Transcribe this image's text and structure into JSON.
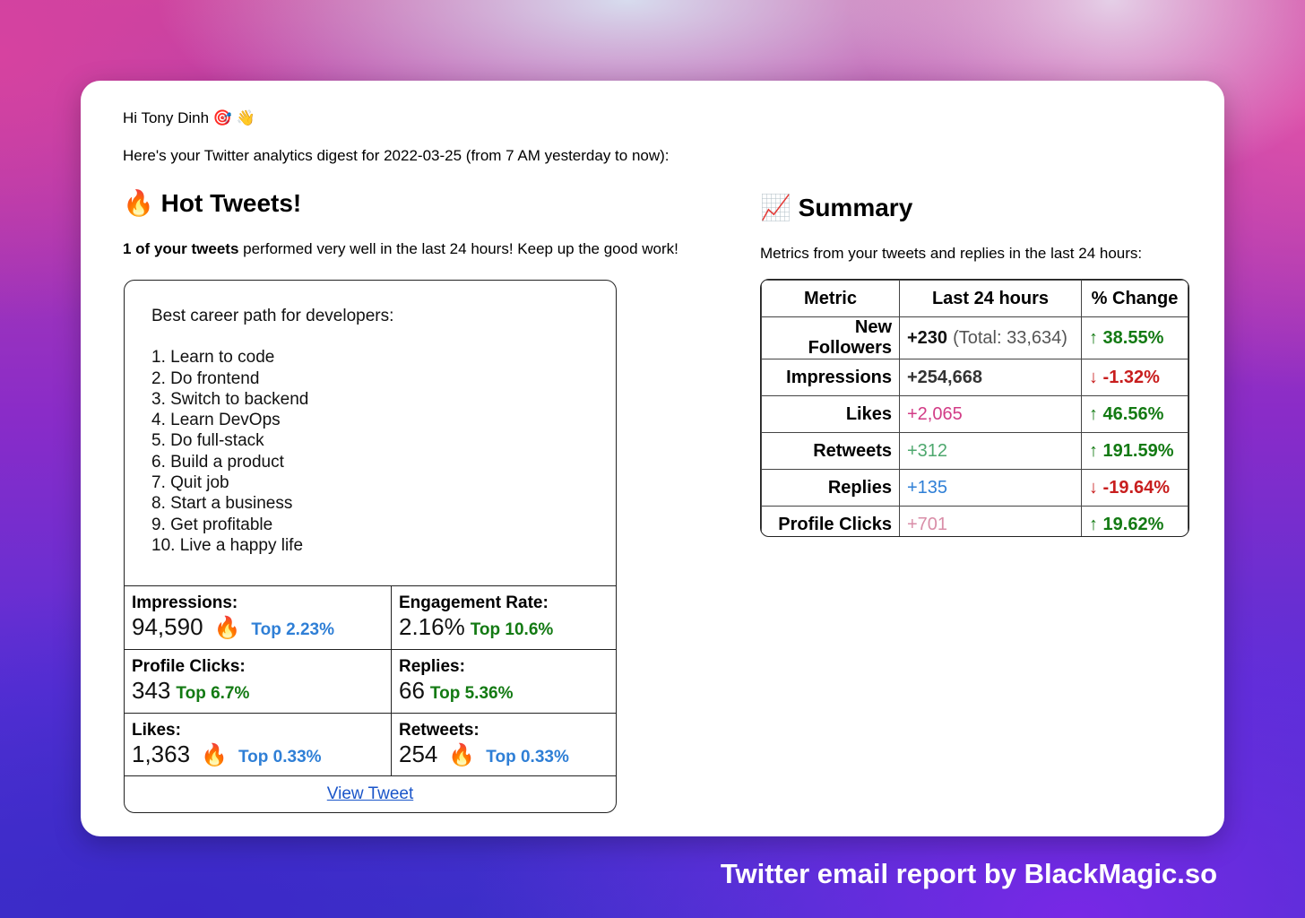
{
  "greeting": "Hi Tony Dinh 🎯 👋",
  "digest_text": "Here's your Twitter analytics digest for 2022-03-25 (from 7 AM yesterday to now):",
  "hot": {
    "icon": "🔥",
    "title": "Hot Tweets!",
    "sub_bold": "1 of your tweets",
    "sub_rest": " performed very well in the last 24 hours! Keep up the good work!",
    "tweet": {
      "heading": "Best career path for developers:",
      "lines": [
        "1. Learn to code",
        "2. Do frontend",
        "3. Switch to backend",
        "4. Learn DevOps",
        "5. Do full-stack",
        "6. Build a product",
        "7. Quit job",
        "8. Start a business",
        "9. Get profitable",
        "10. Live a happy life"
      ]
    },
    "stats": [
      {
        "label": "Impressions:",
        "value": "94,590",
        "fire": "🔥",
        "top": "Top 2.23%",
        "color": "#2f7fd6"
      },
      {
        "label": "Engagement Rate:",
        "value": "2.16%",
        "fire": "",
        "top": "Top 10.6%",
        "color": "#137a13"
      },
      {
        "label": "Profile Clicks:",
        "value": "343",
        "fire": "",
        "top": "Top 6.7%",
        "color": "#137a13"
      },
      {
        "label": "Replies:",
        "value": "66",
        "fire": "",
        "top": "Top 5.36%",
        "color": "#137a13"
      },
      {
        "label": "Likes:",
        "value": "1,363",
        "fire": "🔥",
        "top": "Top 0.33%",
        "color": "#2f7fd6"
      },
      {
        "label": "Retweets:",
        "value": "254",
        "fire": "🔥",
        "top": "Top 0.33%",
        "color": "#2f7fd6"
      }
    ],
    "view_link": "View Tweet"
  },
  "summary": {
    "icon": "📈",
    "title": "Summary",
    "sub": "Metrics from your tweets and replies in the last 24 hours:",
    "headers": [
      "Metric",
      "Last 24 hours",
      "% Change"
    ],
    "rows": [
      {
        "metric": "New Followers",
        "value": "+230",
        "extra": "(Total: 33,634)",
        "value_color": "#111",
        "change": "↑ 38.55%",
        "dir": "up"
      },
      {
        "metric": "Impressions",
        "value": "+254,668",
        "extra": "",
        "value_color": "#333",
        "change": "↓ -1.32%",
        "dir": "down"
      },
      {
        "metric": "Likes",
        "value": "+2,065",
        "extra": "",
        "value_color": "#d23c86",
        "change": "↑ 46.56%",
        "dir": "up"
      },
      {
        "metric": "Retweets",
        "value": "+312",
        "extra": "",
        "value_color": "#4ea86e",
        "change": "↑ 191.59%",
        "dir": "up"
      },
      {
        "metric": "Replies",
        "value": "+135",
        "extra": "",
        "value_color": "#2f7fd6",
        "change": "↓ -19.64%",
        "dir": "down"
      },
      {
        "metric": "Profile Clicks",
        "value": "+701",
        "extra": "",
        "value_color": "#d98ea8",
        "change": "↑ 19.62%",
        "dir": "up"
      }
    ]
  },
  "footer": "Twitter email report by BlackMagic.so"
}
